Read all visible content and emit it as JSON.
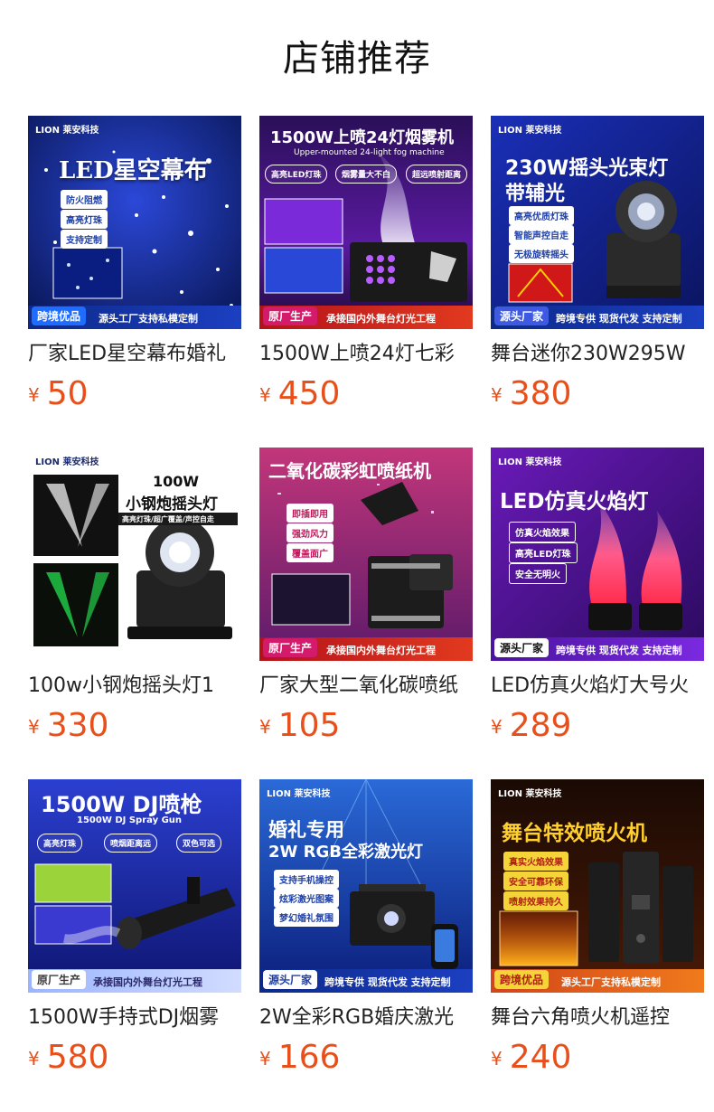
{
  "page": {
    "title": "店铺推荐"
  },
  "currency_symbol": "¥",
  "colors": {
    "price": "#e8501b",
    "title": "#111111"
  },
  "products": [
    {
      "name": "厂家LED星空幕布婚礼",
      "price": "50",
      "image": {
        "brand": "LION 莱安科技",
        "headline": "LED星空幕布",
        "chips": [
          "防火阻燃",
          "高亮灯珠",
          "支持定制"
        ],
        "tag": "跨境优品",
        "footer": "源头工厂支持私模定制"
      }
    },
    {
      "name": "1500W上喷24灯七彩",
      "price": "450",
      "image": {
        "headline": "1500W上喷24灯烟雾机",
        "subline": "Upper-mounted 24-light fog machine",
        "chips": [
          "高亮LED灯珠",
          "烟雾量大不白",
          "超远喷射距离"
        ],
        "tag": "原厂生产",
        "footer": "承接国内外舞台灯光工程"
      }
    },
    {
      "name": "舞台迷你230W295W",
      "price": "380",
      "image": {
        "brand": "LION 莱安科技",
        "headline": "230W摇头光束灯",
        "headline2": "带辅光",
        "chips": [
          "高亮优质灯珠",
          "智能声控自走",
          "无极旋转摇头"
        ],
        "tag": "源头厂家",
        "footer": "跨境专供  现货代发  支持定制"
      }
    },
    {
      "name": "100w小钢炮摇头灯1",
      "price": "330",
      "image": {
        "brand": "LION 莱安科技",
        "headline": "100W",
        "headline2": "小钢炮摇头灯",
        "strip": "高亮灯珠/超广覆盖/声控自走"
      }
    },
    {
      "name": "厂家大型二氧化碳喷纸",
      "price": "105",
      "image": {
        "headline": "二氧化碳彩虹喷纸机",
        "chips": [
          "即插即用",
          "强劲风力",
          "覆盖面广"
        ],
        "tag": "原厂生产",
        "footer": "承接国内外舞台灯光工程"
      }
    },
    {
      "name": "LED仿真火焰灯大号火",
      "price": "289",
      "image": {
        "brand": "LION 莱安科技",
        "headline": "LED仿真火焰灯",
        "chips": [
          "仿真火焰效果",
          "高亮LED灯珠",
          "安全无明火"
        ],
        "tag": "源头厂家",
        "footer": "跨境专供  现货代发  支持定制"
      }
    },
    {
      "name": "1500W手持式DJ烟雾",
      "price": "580",
      "image": {
        "headline": "1500W  DJ喷枪",
        "subline": "1500W DJ Spray Gun",
        "chips": [
          "高亮灯珠",
          "喷烟距离远",
          "双色可选"
        ],
        "tag": "原厂生产",
        "footer": "承接国内外舞台灯光工程"
      }
    },
    {
      "name": "2W全彩RGB婚庆激光",
      "price": "166",
      "image": {
        "brand": "LION 莱安科技",
        "headline": "婚礼专用",
        "headline2": "2W RGB全彩激光灯",
        "chips": [
          "支持手机操控",
          "炫彩激光图案",
          "梦幻婚礼氛围"
        ],
        "tag": "源头厂家",
        "footer": "跨境专供  现货代发  支持定制"
      }
    },
    {
      "name": "舞台六角喷火机遥控",
      "price": "240",
      "image": {
        "brand": "LION 莱安科技",
        "headline": "舞台特效喷火机",
        "chips": [
          "真实火焰效果",
          "安全可靠环保",
          "喷射效果持久"
        ],
        "tag": "跨境优品",
        "footer": "源头工厂支持私模定制"
      }
    }
  ]
}
